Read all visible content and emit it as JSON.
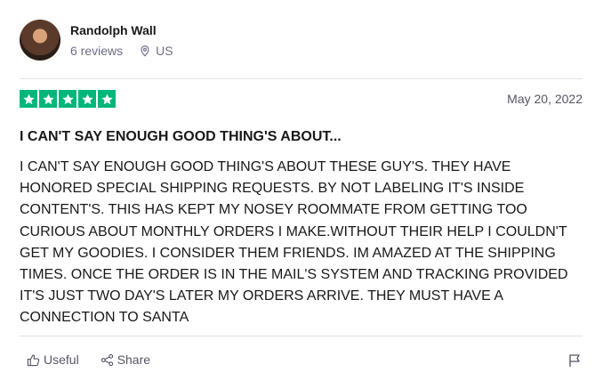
{
  "reviewer": {
    "name": "Randolph Wall",
    "reviews": "6 reviews",
    "country": "US"
  },
  "review": {
    "rating": 5,
    "max_rating": 5,
    "date": "May 20, 2022",
    "title": "I CAN'T SAY ENOUGH GOOD THING'S ABOUT...",
    "body": "I CAN'T SAY ENOUGH GOOD THING'S ABOUT THESE GUY'S. THEY HAVE HONORED SPECIAL SHIPPING REQUESTS. BY NOT LABELING IT'S INSIDE CONTENT'S. THIS HAS KEPT MY NOSEY ROOMMATE FROM GETTING TOO CURIOUS ABOUT MONTHLY ORDERS I MAKE.WITHOUT THEIR HELP I COULDN'T GET MY GOODIES. I CONSIDER THEM FRIENDS. IM AMAZED AT THE SHIPPING TIMES. ONCE THE ORDER IS IN THE MAIL'S SYSTEM AND TRACKING PROVIDED IT'S JUST TWO DAY'S LATER MY ORDERS ARRIVE. THEY MUST HAVE A CONNECTION TO SANTA"
  },
  "actions": {
    "useful_label": "Useful",
    "share_label": "Share"
  },
  "colors": {
    "star_green": "#00b67a",
    "muted_text": "#6c6c85"
  },
  "icons": [
    "location-pin-icon",
    "star-icon",
    "thumbs-up-icon",
    "share-icon",
    "flag-icon"
  ]
}
